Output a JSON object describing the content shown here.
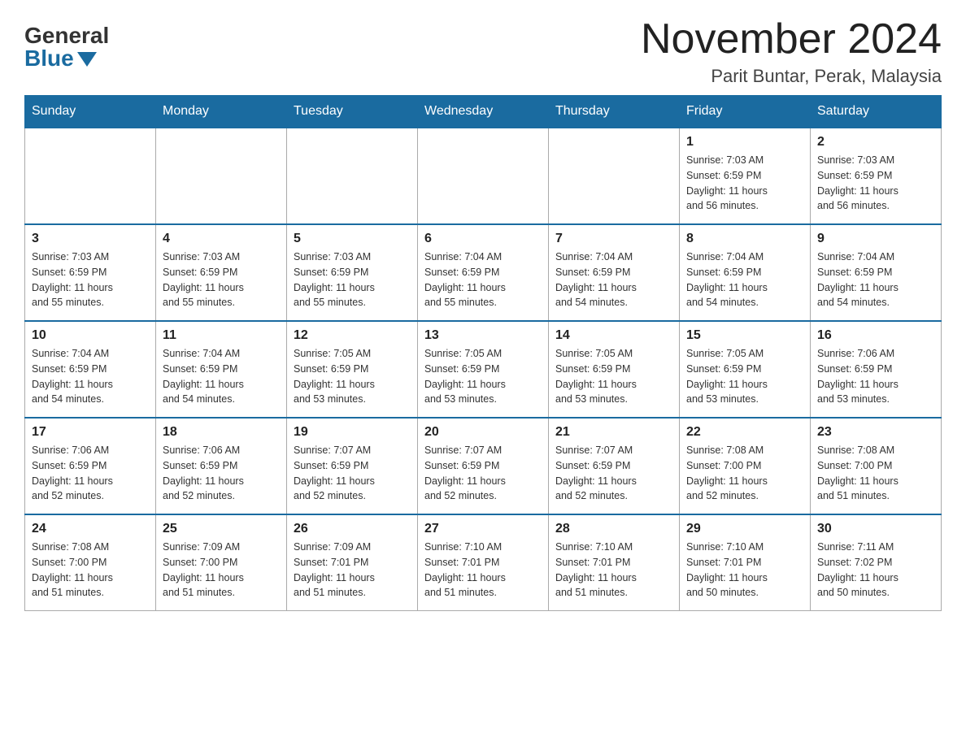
{
  "header": {
    "logo_general": "General",
    "logo_blue": "Blue",
    "month_title": "November 2024",
    "location": "Parit Buntar, Perak, Malaysia"
  },
  "weekdays": [
    "Sunday",
    "Monday",
    "Tuesday",
    "Wednesday",
    "Thursday",
    "Friday",
    "Saturday"
  ],
  "weeks": [
    [
      {
        "day": "",
        "info": ""
      },
      {
        "day": "",
        "info": ""
      },
      {
        "day": "",
        "info": ""
      },
      {
        "day": "",
        "info": ""
      },
      {
        "day": "",
        "info": ""
      },
      {
        "day": "1",
        "info": "Sunrise: 7:03 AM\nSunset: 6:59 PM\nDaylight: 11 hours\nand 56 minutes."
      },
      {
        "day": "2",
        "info": "Sunrise: 7:03 AM\nSunset: 6:59 PM\nDaylight: 11 hours\nand 56 minutes."
      }
    ],
    [
      {
        "day": "3",
        "info": "Sunrise: 7:03 AM\nSunset: 6:59 PM\nDaylight: 11 hours\nand 55 minutes."
      },
      {
        "day": "4",
        "info": "Sunrise: 7:03 AM\nSunset: 6:59 PM\nDaylight: 11 hours\nand 55 minutes."
      },
      {
        "day": "5",
        "info": "Sunrise: 7:03 AM\nSunset: 6:59 PM\nDaylight: 11 hours\nand 55 minutes."
      },
      {
        "day": "6",
        "info": "Sunrise: 7:04 AM\nSunset: 6:59 PM\nDaylight: 11 hours\nand 55 minutes."
      },
      {
        "day": "7",
        "info": "Sunrise: 7:04 AM\nSunset: 6:59 PM\nDaylight: 11 hours\nand 54 minutes."
      },
      {
        "day": "8",
        "info": "Sunrise: 7:04 AM\nSunset: 6:59 PM\nDaylight: 11 hours\nand 54 minutes."
      },
      {
        "day": "9",
        "info": "Sunrise: 7:04 AM\nSunset: 6:59 PM\nDaylight: 11 hours\nand 54 minutes."
      }
    ],
    [
      {
        "day": "10",
        "info": "Sunrise: 7:04 AM\nSunset: 6:59 PM\nDaylight: 11 hours\nand 54 minutes."
      },
      {
        "day": "11",
        "info": "Sunrise: 7:04 AM\nSunset: 6:59 PM\nDaylight: 11 hours\nand 54 minutes."
      },
      {
        "day": "12",
        "info": "Sunrise: 7:05 AM\nSunset: 6:59 PM\nDaylight: 11 hours\nand 53 minutes."
      },
      {
        "day": "13",
        "info": "Sunrise: 7:05 AM\nSunset: 6:59 PM\nDaylight: 11 hours\nand 53 minutes."
      },
      {
        "day": "14",
        "info": "Sunrise: 7:05 AM\nSunset: 6:59 PM\nDaylight: 11 hours\nand 53 minutes."
      },
      {
        "day": "15",
        "info": "Sunrise: 7:05 AM\nSunset: 6:59 PM\nDaylight: 11 hours\nand 53 minutes."
      },
      {
        "day": "16",
        "info": "Sunrise: 7:06 AM\nSunset: 6:59 PM\nDaylight: 11 hours\nand 53 minutes."
      }
    ],
    [
      {
        "day": "17",
        "info": "Sunrise: 7:06 AM\nSunset: 6:59 PM\nDaylight: 11 hours\nand 52 minutes."
      },
      {
        "day": "18",
        "info": "Sunrise: 7:06 AM\nSunset: 6:59 PM\nDaylight: 11 hours\nand 52 minutes."
      },
      {
        "day": "19",
        "info": "Sunrise: 7:07 AM\nSunset: 6:59 PM\nDaylight: 11 hours\nand 52 minutes."
      },
      {
        "day": "20",
        "info": "Sunrise: 7:07 AM\nSunset: 6:59 PM\nDaylight: 11 hours\nand 52 minutes."
      },
      {
        "day": "21",
        "info": "Sunrise: 7:07 AM\nSunset: 6:59 PM\nDaylight: 11 hours\nand 52 minutes."
      },
      {
        "day": "22",
        "info": "Sunrise: 7:08 AM\nSunset: 7:00 PM\nDaylight: 11 hours\nand 52 minutes."
      },
      {
        "day": "23",
        "info": "Sunrise: 7:08 AM\nSunset: 7:00 PM\nDaylight: 11 hours\nand 51 minutes."
      }
    ],
    [
      {
        "day": "24",
        "info": "Sunrise: 7:08 AM\nSunset: 7:00 PM\nDaylight: 11 hours\nand 51 minutes."
      },
      {
        "day": "25",
        "info": "Sunrise: 7:09 AM\nSunset: 7:00 PM\nDaylight: 11 hours\nand 51 minutes."
      },
      {
        "day": "26",
        "info": "Sunrise: 7:09 AM\nSunset: 7:01 PM\nDaylight: 11 hours\nand 51 minutes."
      },
      {
        "day": "27",
        "info": "Sunrise: 7:10 AM\nSunset: 7:01 PM\nDaylight: 11 hours\nand 51 minutes."
      },
      {
        "day": "28",
        "info": "Sunrise: 7:10 AM\nSunset: 7:01 PM\nDaylight: 11 hours\nand 51 minutes."
      },
      {
        "day": "29",
        "info": "Sunrise: 7:10 AM\nSunset: 7:01 PM\nDaylight: 11 hours\nand 50 minutes."
      },
      {
        "day": "30",
        "info": "Sunrise: 7:11 AM\nSunset: 7:02 PM\nDaylight: 11 hours\nand 50 minutes."
      }
    ]
  ]
}
